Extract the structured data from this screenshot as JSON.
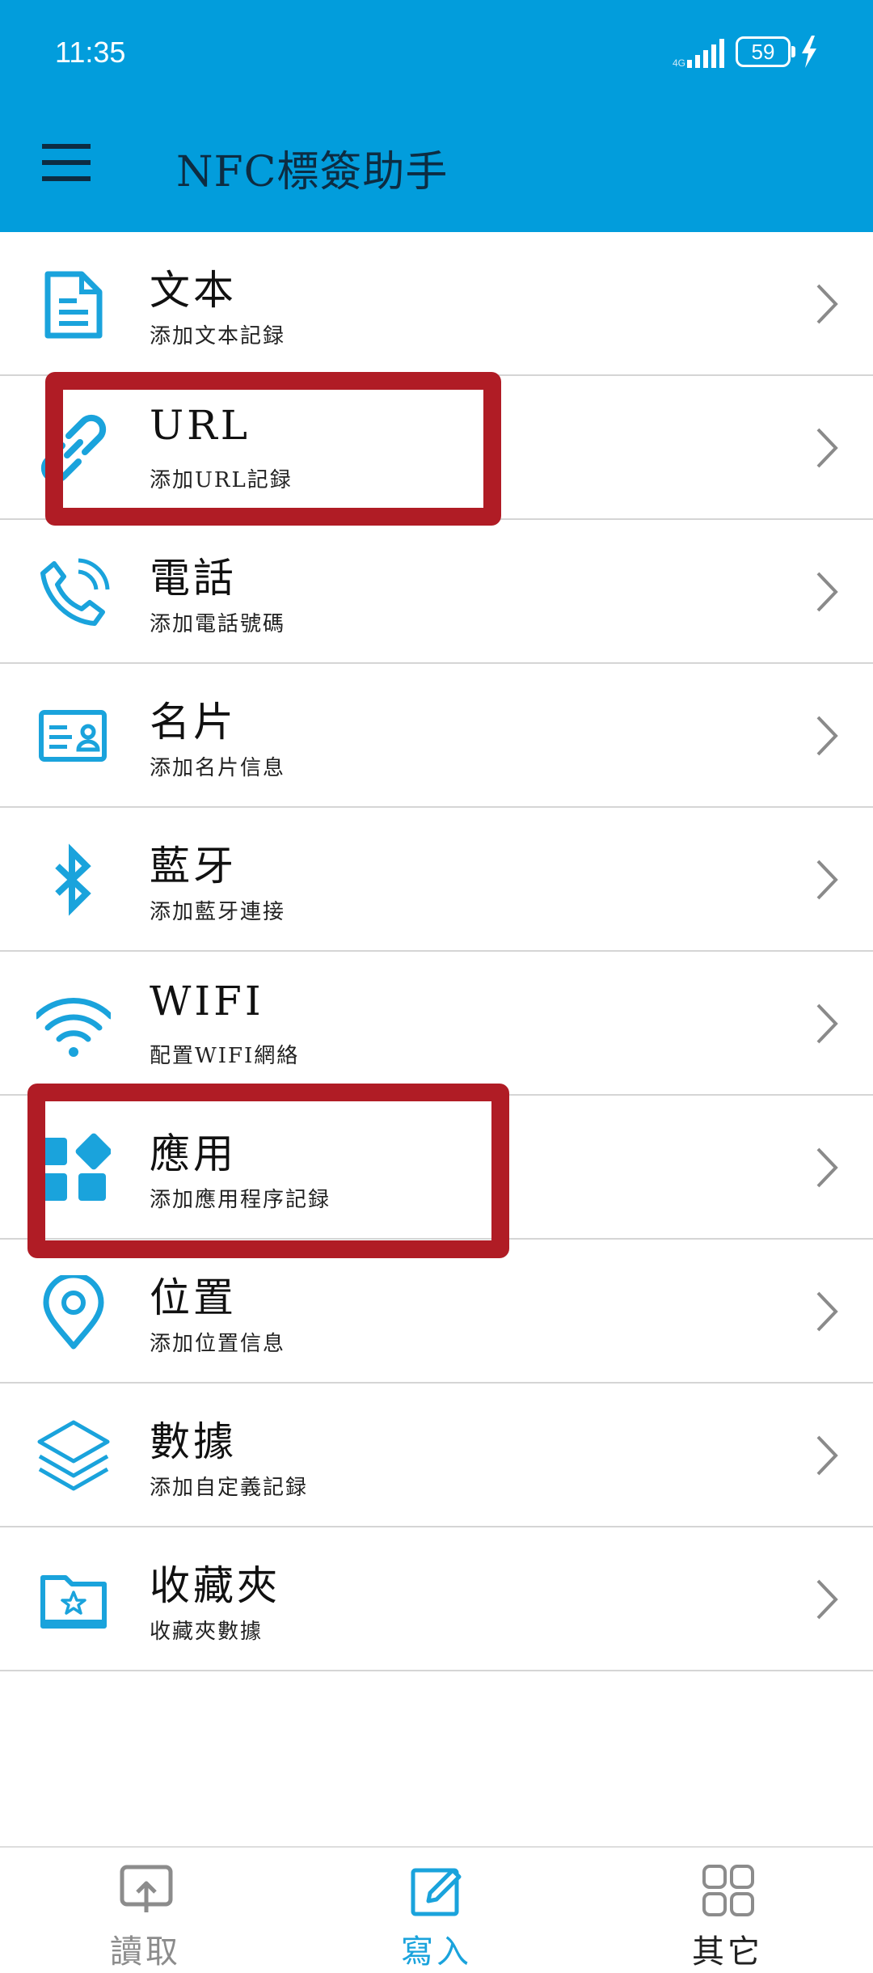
{
  "status_bar": {
    "time": "11:35",
    "battery": "59"
  },
  "app_bar": {
    "title": "NFC標簽助手"
  },
  "colors": {
    "primary": "#029ddc",
    "highlight": "#b01c25",
    "text": "#111111"
  },
  "items": [
    {
      "title": "文本",
      "subtitle": "添加文本記録",
      "icon": "document-icon"
    },
    {
      "title": "URL",
      "subtitle": "添加URL記録",
      "icon": "link-icon"
    },
    {
      "title": "電話",
      "subtitle": "添加電話號碼",
      "icon": "phone-icon"
    },
    {
      "title": "名片",
      "subtitle": "添加名片信息",
      "icon": "contact-card-icon"
    },
    {
      "title": "藍牙",
      "subtitle": "添加藍牙連接",
      "icon": "bluetooth-icon"
    },
    {
      "title": "WIFI",
      "subtitle": "配置WIFI網絡",
      "icon": "wifi-icon"
    },
    {
      "title": "應用",
      "subtitle": "添加應用程序記録",
      "icon": "apps-icon"
    },
    {
      "title": "位置",
      "subtitle": "添加位置信息",
      "icon": "location-pin-icon"
    },
    {
      "title": "數據",
      "subtitle": "添加自定義記録",
      "icon": "layers-icon"
    },
    {
      "title": "收藏夾",
      "subtitle": "收藏夾數據",
      "icon": "favorites-folder-icon"
    }
  ],
  "tabs": [
    {
      "label": "讀取",
      "icon": "read-icon",
      "active": false
    },
    {
      "label": "寫入",
      "icon": "write-icon",
      "active": true
    },
    {
      "label": "其它",
      "icon": "grid-icon",
      "active": false
    }
  ]
}
